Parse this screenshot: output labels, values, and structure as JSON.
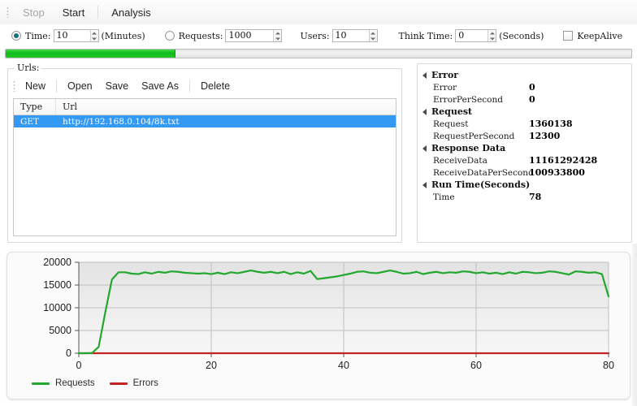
{
  "menubar": {
    "items": [
      {
        "label": "Stop",
        "enabled": false,
        "name": "menu-stop"
      },
      {
        "label": "Start",
        "enabled": true,
        "name": "menu-start"
      },
      {
        "label": "Analysis",
        "enabled": true,
        "name": "menu-analysis"
      }
    ]
  },
  "options": {
    "time": {
      "radio_label": "Time:",
      "value": "10",
      "unit": "(Minutes)",
      "selected": true
    },
    "requests": {
      "radio_label": "Requests:",
      "value": "1000",
      "unit": "",
      "selected": false
    },
    "users": {
      "label": "Users:",
      "value": "10"
    },
    "think_time": {
      "label": "Think Time:",
      "value": "0",
      "unit": "(Seconds)"
    },
    "keepalive": {
      "label": "KeepAlive",
      "checked": false
    }
  },
  "progress": {
    "percent": 27,
    "color": "#17c426"
  },
  "urls_panel": {
    "title": "Urls:",
    "toolbar": [
      {
        "label": "New",
        "name": "urls-new-button"
      },
      {
        "label": "Open",
        "name": "urls-open-button"
      },
      {
        "label": "Save",
        "name": "urls-save-button"
      },
      {
        "label": "Save As",
        "name": "urls-save-as-button"
      },
      {
        "label": "Delete",
        "name": "urls-delete-button"
      }
    ],
    "columns": [
      "Type",
      "Url"
    ],
    "rows": [
      {
        "type": "GET",
        "url": "http://192.168.0.104/8k.txt",
        "selected": true
      }
    ]
  },
  "stats": {
    "groups": [
      {
        "label": "Error",
        "rows": [
          {
            "key": "Error",
            "value": "0"
          },
          {
            "key": "ErrorPerSecond",
            "value": "0"
          }
        ]
      },
      {
        "label": "Request",
        "rows": [
          {
            "key": "Request",
            "value": "1360138"
          },
          {
            "key": "RequestPerSecond",
            "value": "12300"
          }
        ]
      },
      {
        "label": "Response Data",
        "rows": [
          {
            "key": "ReceiveData",
            "value": "11161292428"
          },
          {
            "key": "ReceiveDataPerSecond",
            "value": "100933800"
          }
        ]
      },
      {
        "label": "Run Time(Seconds)",
        "rows": [
          {
            "key": "Time",
            "value": "78"
          }
        ]
      }
    ]
  },
  "chart_data": {
    "type": "line",
    "title": "",
    "xlabel": "",
    "ylabel": "",
    "xlim": [
      0,
      80
    ],
    "ylim": [
      0,
      20000
    ],
    "xticks": [
      0,
      20,
      40,
      60,
      80
    ],
    "yticks": [
      0,
      5000,
      10000,
      15000,
      20000
    ],
    "grid": true,
    "legend_position": "bottom-left",
    "series": [
      {
        "name": "Requests",
        "color": "#22a82e",
        "x": [
          0,
          1,
          2,
          3,
          4,
          5,
          6,
          7,
          8,
          9,
          10,
          11,
          12,
          13,
          14,
          15,
          16,
          17,
          18,
          19,
          20,
          21,
          22,
          23,
          24,
          25,
          26,
          27,
          28,
          29,
          30,
          31,
          32,
          33,
          34,
          35,
          36,
          37,
          38,
          39,
          40,
          41,
          42,
          43,
          44,
          45,
          46,
          47,
          48,
          49,
          50,
          51,
          52,
          53,
          54,
          55,
          56,
          57,
          58,
          59,
          60,
          61,
          62,
          63,
          64,
          65,
          66,
          67,
          68,
          69,
          70,
          71,
          72,
          73,
          74,
          75,
          76,
          77,
          78,
          79,
          80
        ],
        "values": [
          0,
          0,
          60,
          1400,
          9000,
          16200,
          17800,
          17800,
          17500,
          17400,
          17800,
          17500,
          17900,
          17700,
          18000,
          17900,
          17700,
          17600,
          17500,
          17600,
          17400,
          17700,
          17400,
          17800,
          17600,
          17900,
          18200,
          17900,
          17700,
          17900,
          17600,
          17900,
          17400,
          17800,
          17500,
          18100,
          16300,
          16500,
          16700,
          16900,
          17200,
          17500,
          17900,
          18000,
          17700,
          17600,
          17900,
          18200,
          17900,
          17500,
          17600,
          17900,
          17400,
          17700,
          17900,
          17600,
          17800,
          17700,
          18000,
          17900,
          17600,
          17800,
          17500,
          17700,
          17400,
          17800,
          17500,
          17900,
          17800,
          17600,
          17700,
          18000,
          17900,
          17600,
          17300,
          18000,
          17900,
          17700,
          17800,
          17400,
          12500
        ]
      },
      {
        "name": "Errors",
        "color": "#c42222",
        "x": [
          0,
          10,
          20,
          30,
          40,
          50,
          60,
          70,
          80
        ],
        "values": [
          0,
          0,
          0,
          0,
          0,
          0,
          0,
          0,
          0
        ]
      }
    ]
  }
}
